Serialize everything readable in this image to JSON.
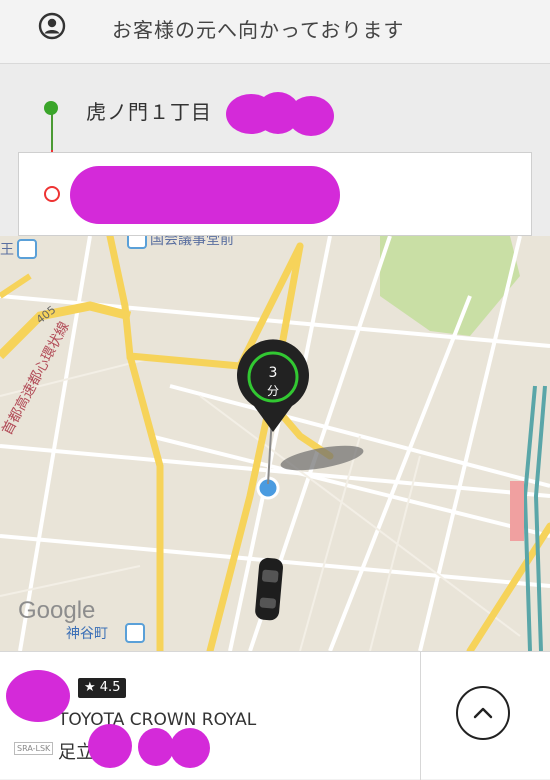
{
  "header": {
    "title": "お客様の元へ向かっております",
    "user_icon": "account-circle-icon"
  },
  "route": {
    "pickup": "虎ノ門１丁目",
    "destination": ""
  },
  "map": {
    "google_logo": "Google",
    "labels": {
      "station_kamiyacho": "神谷町",
      "kokkai_mae": "国会議事堂前",
      "highway": "首都高速都心環状線",
      "route_405": "405",
      "station_left": "王"
    },
    "eta": {
      "value": "3",
      "unit": "分"
    },
    "colors": {
      "road_major": "#f6d35a",
      "park": "#c9dfa5",
      "eta_ring": "#32c832",
      "location_dot": "#4a9be0"
    }
  },
  "driver": {
    "rating": "★ 4.5",
    "car_model": "TOYOTA CROWN ROYAL",
    "plate_prefix": "足立",
    "plate_icon_label": "SRA-LSK"
  },
  "controls": {
    "expand_icon": "chevron-up-icon"
  }
}
